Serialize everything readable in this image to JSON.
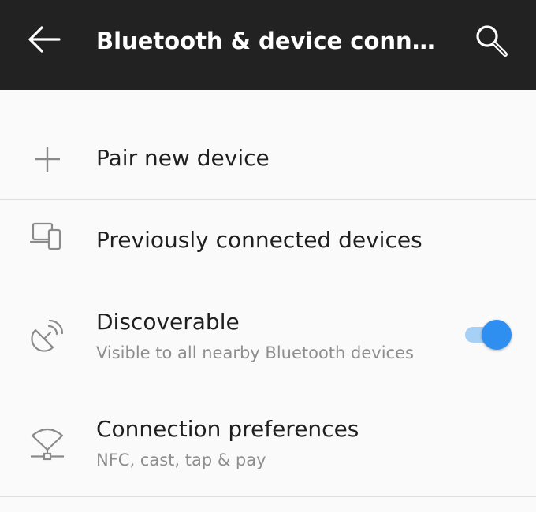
{
  "appbar": {
    "title": "Bluetooth & device connections",
    "back_icon": "arrow-left-icon",
    "search_icon": "search-icon"
  },
  "items": [
    {
      "primary": "Pair new device",
      "icon": "plus-icon"
    },
    {
      "primary": "Previously connected devices",
      "icon": "devices-icon"
    },
    {
      "primary": "Discoverable",
      "secondary": "Visible to all nearby Bluetooth devices",
      "icon": "satellite-dish-icon",
      "toggle_on": true
    },
    {
      "primary": "Connection preferences",
      "secondary": "NFC, cast, tap & pay",
      "icon": "network-wifi-icon"
    }
  ],
  "colors": {
    "appbar": "#222222",
    "background": "#fafafa",
    "accent": "#2f8ff0",
    "accent_track": "#a7d0f6",
    "primary_text": "#1f1f1f",
    "secondary_text": "#8e8e8e",
    "icon": "#8a8a8a"
  }
}
